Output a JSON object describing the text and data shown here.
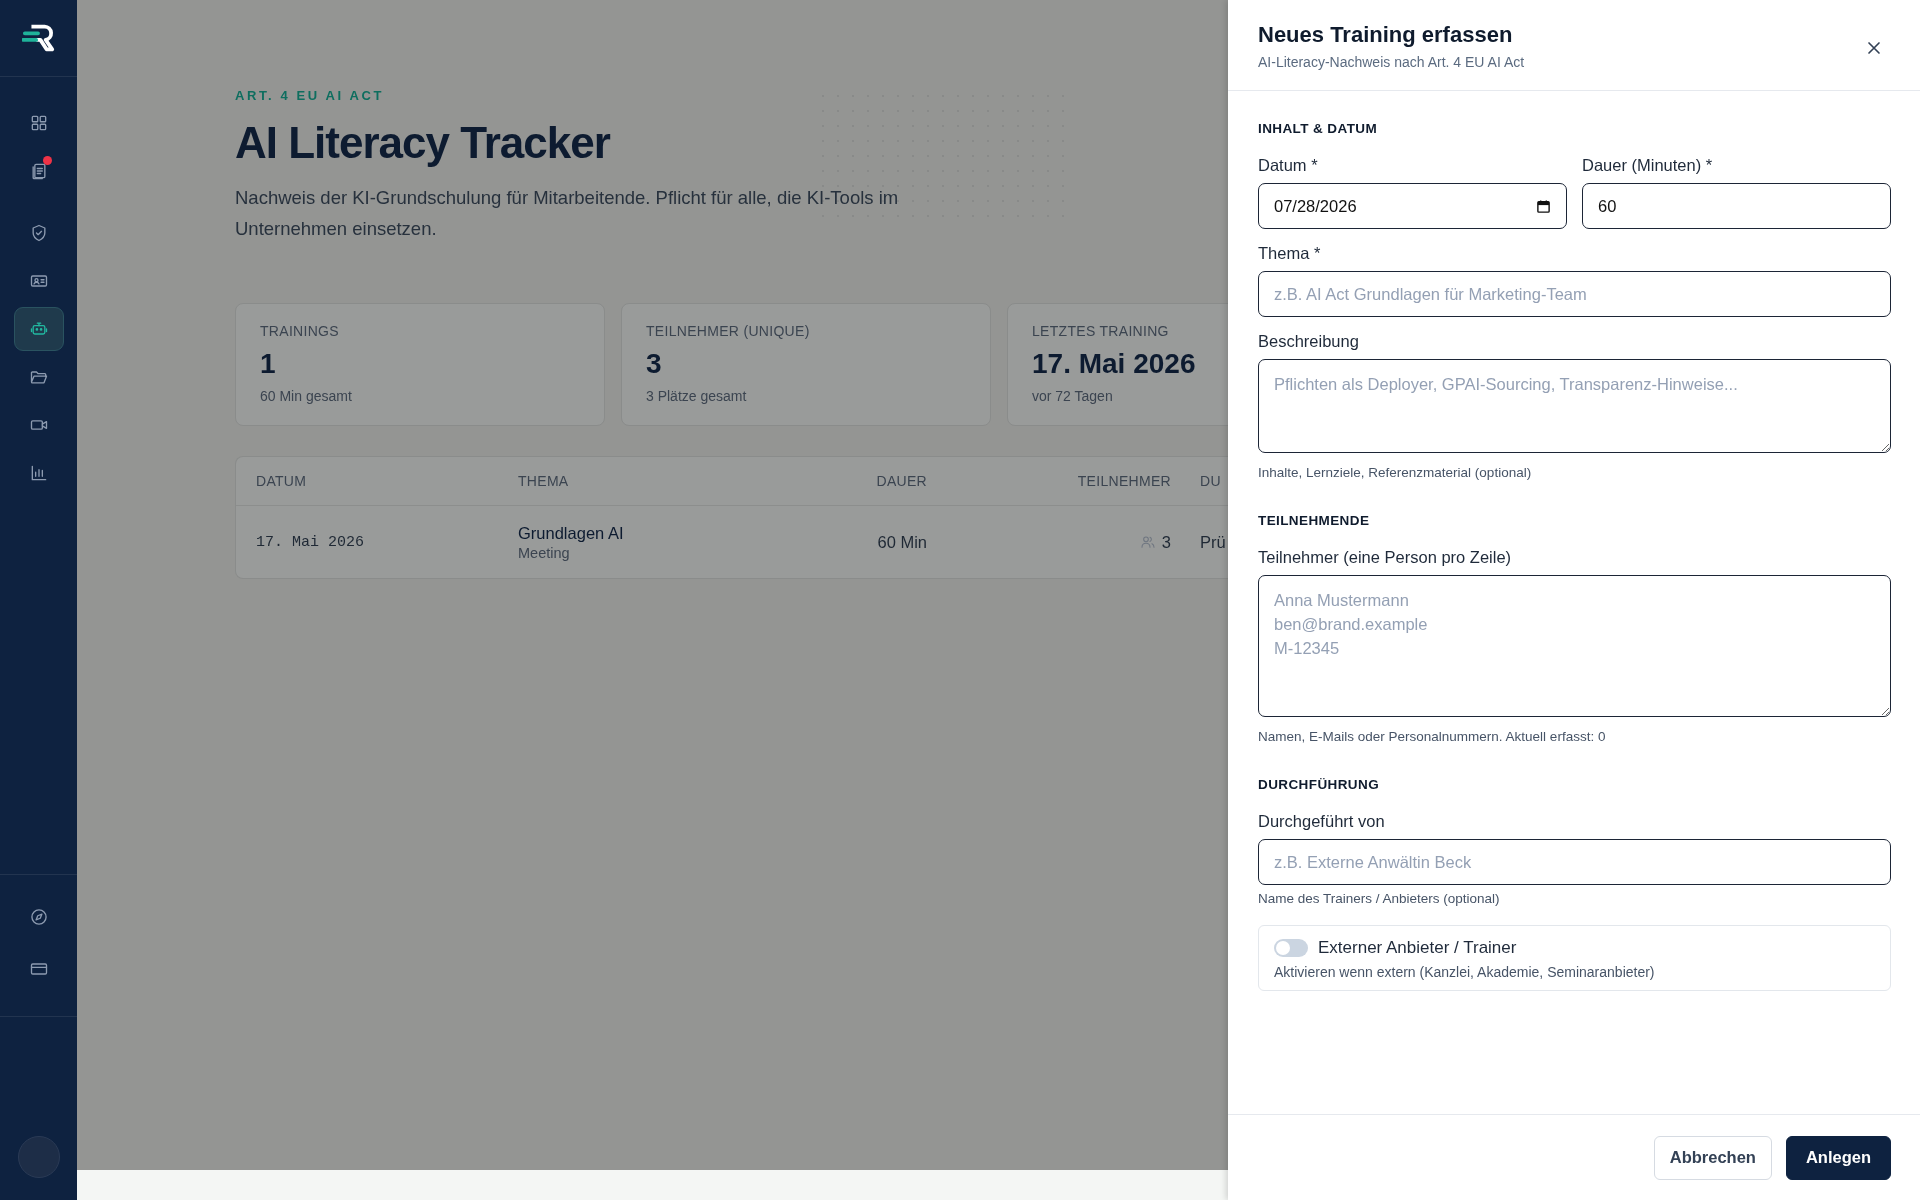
{
  "sidebar": {
    "items": [
      {
        "selected": false,
        "badge": false
      },
      {
        "selected": false,
        "badge": true
      },
      {
        "selected": false,
        "badge": false
      },
      {
        "selected": false,
        "badge": false
      },
      {
        "selected": true,
        "badge": false
      },
      {
        "selected": false,
        "badge": false
      },
      {
        "selected": false,
        "badge": false
      },
      {
        "selected": false,
        "badge": false
      }
    ],
    "bottom_items": [
      {
        "selected": false
      },
      {
        "selected": false
      }
    ]
  },
  "page": {
    "eyebrow": "ART. 4 EU AI ACT",
    "title": "AI Literacy Tracker",
    "subtitle": "Nachweis der KI-Grundschulung für Mitarbeitende. Pflicht für alle, die KI-Tools im Unternehmen einsetzen."
  },
  "stats": [
    {
      "label": "TRAININGS",
      "value": "1",
      "sub": "60 Min gesamt"
    },
    {
      "label": "TEILNEHMER (UNIQUE)",
      "value": "3",
      "sub": "3 Plätze gesamt"
    },
    {
      "label": "LETZTES TRAINING",
      "value": "17. Mai 2026",
      "sub": "vor 72 Tagen"
    }
  ],
  "table": {
    "columns": [
      "DATUM",
      "THEMA",
      "DAUER",
      "TEILNEHMER",
      "DU"
    ],
    "rows": [
      {
        "datum": "17. Mai 2026",
        "thema": "Grundlagen AI",
        "typ": "Meeting",
        "dauer": "60 Min",
        "teilnehmer": "3",
        "column_5": "Prü"
      }
    ]
  },
  "drawer": {
    "title": "Neues Training erfassen",
    "subtitle": "AI-Literacy-Nachweis nach Art. 4 EU AI Act",
    "sections": [
      {
        "title": "INHALT & DATUM",
        "fields": [
          {
            "kind": "pair",
            "fields": [
              {
                "kind": "date",
                "label": "Datum *",
                "value": "07/28/2026"
              },
              {
                "kind": "input",
                "label": "Dauer (Minuten) *",
                "value": "60"
              }
            ]
          },
          {
            "kind": "input",
            "label": "Thema *",
            "placeholder": "z.B. AI Act Grundlagen für Marketing-Team"
          },
          {
            "kind": "textarea",
            "label": "Beschreibung",
            "placeholder": "Pflichten als Deployer, GPAI-Sourcing, Transparenz-Hinweise...",
            "help": "Inhalte, Lernziele, Referenzmaterial (optional)"
          }
        ]
      },
      {
        "title": "TEILNEHMENDE",
        "fields": [
          {
            "kind": "listarea",
            "label": "Teilnehmer (eine Person pro Zeile)",
            "placeholder": "Anna Mustermann\nben@brand.example\nM-12345",
            "help": "Namen, E-Mails oder Personalnummern. Aktuell erfasst: 0"
          }
        ]
      },
      {
        "title": "DURCHFÜHRUNG",
        "fields": [
          {
            "kind": "input",
            "label": "Durchgeführt von",
            "placeholder": "z.B. Externe Anwältin Beck",
            "help": "Name des Trainers / Anbieters (optional)"
          },
          {
            "kind": "switch",
            "label": "Externer Anbieter / Trainer",
            "help": "Aktivieren wenn extern (Kanzlei, Akademie, Seminaranbieter)",
            "on": false
          }
        ]
      }
    ],
    "buttons": [
      {
        "label": "Abbrechen",
        "kind": "secondary"
      },
      {
        "label": "Anlegen",
        "kind": "primary"
      }
    ]
  }
}
